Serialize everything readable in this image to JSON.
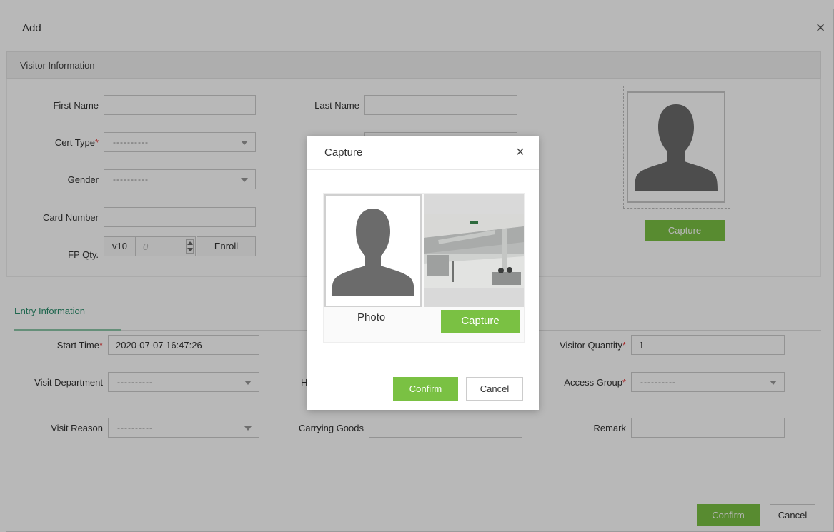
{
  "dialog": {
    "title": "Add",
    "close_glyph": "×",
    "section_visitor": "Visitor Information",
    "fields": {
      "first_name": {
        "label": "First Name",
        "value": ""
      },
      "last_name": {
        "label": "Last Name",
        "value": ""
      },
      "cert_type": {
        "label": "Cert Type",
        "required_mark": "*",
        "value": "----------"
      },
      "gender": {
        "label": "Gender",
        "value": "----------"
      },
      "card_number": {
        "label": "Card Number",
        "value": ""
      },
      "fp_qty": {
        "label": "FP Qty.",
        "version": "v10",
        "count": "0",
        "enroll_label": "Enroll"
      }
    },
    "photo": {
      "capture_label": "Capture",
      "placeholder_icon": "person-silhouette-icon"
    },
    "tab_entry": "Entry Information",
    "entry": {
      "start_time": {
        "label": "Start Time",
        "required_mark": "*",
        "value": "2020-07-07 16:47:26"
      },
      "visitor_quantity": {
        "label": "Visitor Quantity",
        "required_mark": "*",
        "value": "1"
      },
      "visit_department": {
        "label": "Visit Department",
        "value": "----------"
      },
      "host_label_fragment": "H",
      "access_group": {
        "label": "Access Group",
        "required_mark": "*",
        "value": "----------"
      },
      "visit_reason": {
        "label": "Visit Reason",
        "value": "----------"
      },
      "carrying_goods": {
        "label": "Carrying Goods",
        "value": ""
      },
      "remark": {
        "label": "Remark",
        "value": ""
      }
    },
    "footer": {
      "confirm_label": "Confirm",
      "cancel_label": "Cancel"
    }
  },
  "capture_modal": {
    "title": "Capture",
    "close_glyph": "×",
    "photo_label": "Photo",
    "capture_label": "Capture",
    "confirm_label": "Confirm",
    "cancel_label": "Cancel",
    "camera_preview": "live-camera-feed"
  },
  "colors": {
    "accent_green": "#7ac143",
    "required_red": "#e63b3b",
    "tab_green": "#2d8f6e"
  }
}
